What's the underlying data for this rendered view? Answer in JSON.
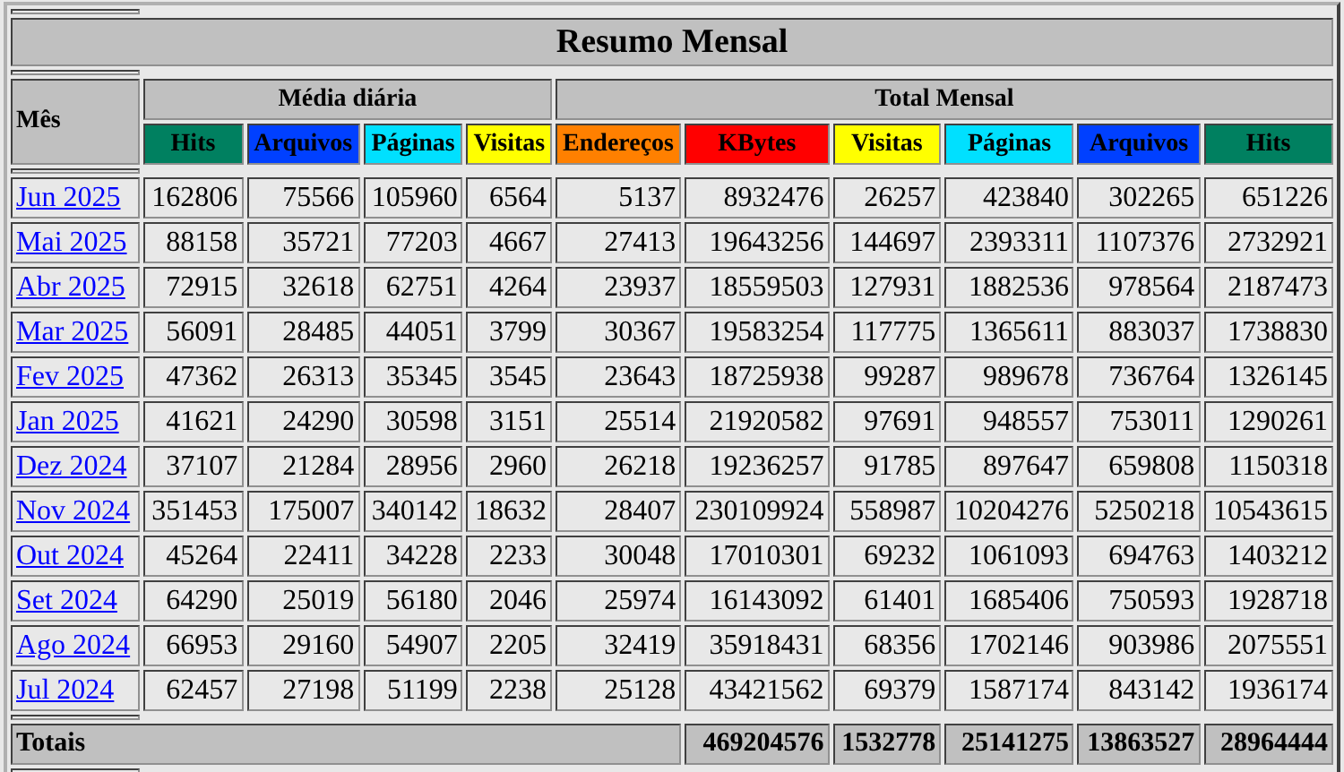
{
  "title": "Resumo Mensal",
  "month_header": "Mês",
  "groups": [
    {
      "label": "Média diária",
      "columns": [
        {
          "label": "Hits",
          "color": "#008060"
        },
        {
          "label": "Arquivos",
          "color": "#0040ff"
        },
        {
          "label": "Páginas",
          "color": "#00e0ff"
        },
        {
          "label": "Visitas",
          "color": "#ffff00"
        }
      ]
    },
    {
      "label": "Total Mensal",
      "columns": [
        {
          "label": "Endereços",
          "color": "#ff8000"
        },
        {
          "label": "KBytes",
          "color": "#ff0000"
        },
        {
          "label": "Visitas",
          "color": "#ffff00"
        },
        {
          "label": "Páginas",
          "color": "#00e0ff"
        },
        {
          "label": "Arquivos",
          "color": "#0040ff"
        },
        {
          "label": "Hits",
          "color": "#008060"
        }
      ]
    }
  ],
  "rows": [
    {
      "month": "Jun 2025",
      "values": [
        "162806",
        "75566",
        "105960",
        "6564",
        "5137",
        "8932476",
        "26257",
        "423840",
        "302265",
        "651226"
      ]
    },
    {
      "month": "Mai 2025",
      "values": [
        "88158",
        "35721",
        "77203",
        "4667",
        "27413",
        "19643256",
        "144697",
        "2393311",
        "1107376",
        "2732921"
      ]
    },
    {
      "month": "Abr 2025",
      "values": [
        "72915",
        "32618",
        "62751",
        "4264",
        "23937",
        "18559503",
        "127931",
        "1882536",
        "978564",
        "2187473"
      ]
    },
    {
      "month": "Mar 2025",
      "values": [
        "56091",
        "28485",
        "44051",
        "3799",
        "30367",
        "19583254",
        "117775",
        "1365611",
        "883037",
        "1738830"
      ]
    },
    {
      "month": "Fev 2025",
      "values": [
        "47362",
        "26313",
        "35345",
        "3545",
        "23643",
        "18725938",
        "99287",
        "989678",
        "736764",
        "1326145"
      ]
    },
    {
      "month": "Jan 2025",
      "values": [
        "41621",
        "24290",
        "30598",
        "3151",
        "25514",
        "21920582",
        "97691",
        "948557",
        "753011",
        "1290261"
      ]
    },
    {
      "month": "Dez 2024",
      "values": [
        "37107",
        "21284",
        "28956",
        "2960",
        "26218",
        "19236257",
        "91785",
        "897647",
        "659808",
        "1150318"
      ]
    },
    {
      "month": "Nov 2024",
      "values": [
        "351453",
        "175007",
        "340142",
        "18632",
        "28407",
        "230109924",
        "558987",
        "10204276",
        "5250218",
        "10543615"
      ]
    },
    {
      "month": "Out 2024",
      "values": [
        "45264",
        "22411",
        "34228",
        "2233",
        "30048",
        "17010301",
        "69232",
        "1061093",
        "694763",
        "1403212"
      ]
    },
    {
      "month": "Set 2024",
      "values": [
        "64290",
        "25019",
        "56180",
        "2046",
        "25974",
        "16143092",
        "61401",
        "1685406",
        "750593",
        "1928718"
      ]
    },
    {
      "month": "Ago 2024",
      "values": [
        "66953",
        "29160",
        "54907",
        "2205",
        "32419",
        "35918431",
        "68356",
        "1702146",
        "903986",
        "2075551"
      ]
    },
    {
      "month": "Jul 2024",
      "values": [
        "62457",
        "27198",
        "51199",
        "2238",
        "25128",
        "43421562",
        "69379",
        "1587174",
        "843142",
        "1936174"
      ]
    }
  ],
  "totals": {
    "label": "Totais",
    "values": [
      "469204576",
      "1532778",
      "25141275",
      "13863527",
      "28964444"
    ]
  }
}
